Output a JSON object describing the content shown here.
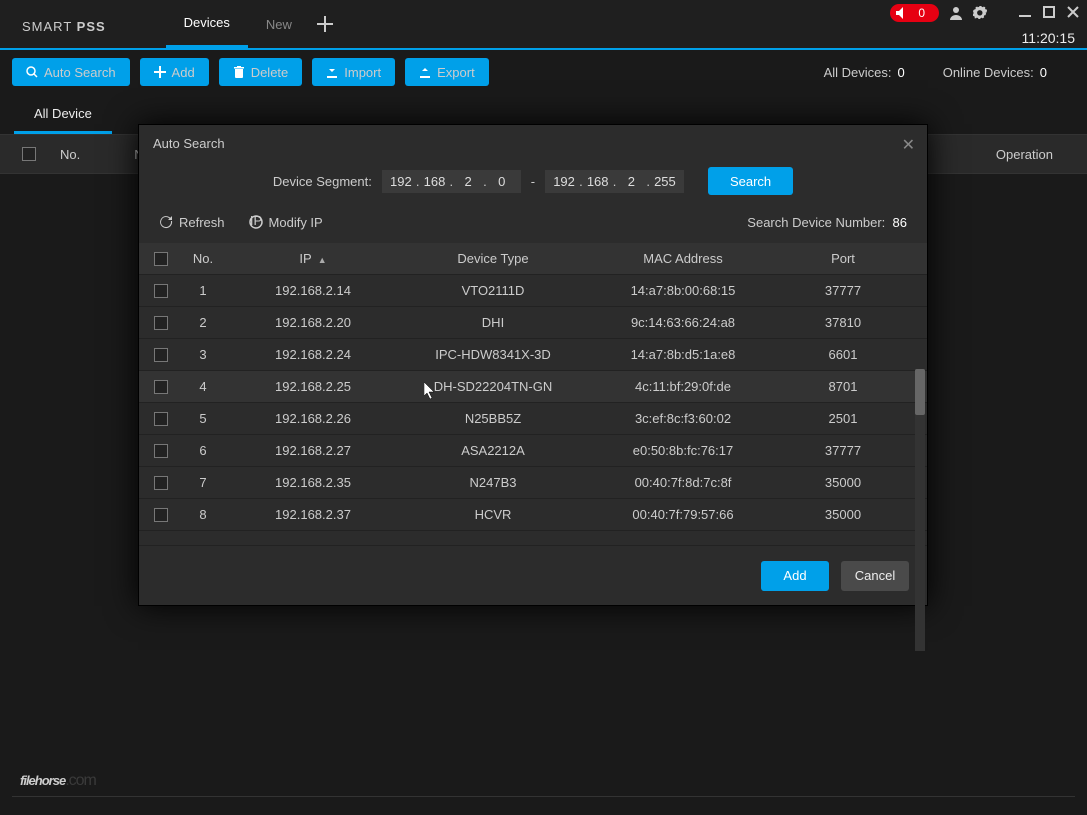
{
  "app": {
    "logo_pre": "SMART ",
    "logo_bold": "PSS",
    "clock": "11:20:15"
  },
  "tabs": {
    "devices": "Devices",
    "new": "New"
  },
  "volume": {
    "count": "0"
  },
  "toolbar": {
    "auto_search": "Auto Search",
    "add": "Add",
    "delete": "Delete",
    "import": "Import",
    "export": "Export",
    "all_devices_label": "All Devices:",
    "all_devices_val": "0",
    "online_devices_label": "Online Devices:",
    "online_devices_val": "0"
  },
  "subtabs": {
    "all_device": "All Device"
  },
  "main_header": {
    "no": "No.",
    "name": "Na",
    "operation": "Operation"
  },
  "modal": {
    "title": "Auto Search",
    "segment_label": "Device Segment:",
    "ip_from": [
      "192",
      "168",
      "2",
      "0"
    ],
    "ip_to": [
      "192",
      "168",
      "2",
      "255"
    ],
    "dash": "-",
    "search_btn": "Search",
    "refresh": "Refresh",
    "modify_ip": "Modify IP",
    "count_label": "Search Device Number:",
    "count_val": "86",
    "cols": {
      "no": "No.",
      "ip": "IP",
      "type": "Device Type",
      "mac": "MAC Address",
      "port": "Port"
    },
    "rows": [
      {
        "no": "1",
        "ip": "192.168.2.14",
        "type": "VTO2111D",
        "mac": "14:a7:8b:00:68:15",
        "port": "37777"
      },
      {
        "no": "2",
        "ip": "192.168.2.20",
        "type": "DHI",
        "mac": "9c:14:63:66:24:a8",
        "port": "37810"
      },
      {
        "no": "3",
        "ip": "192.168.2.24",
        "type": "IPC-HDW8341X-3D",
        "mac": "14:a7:8b:d5:1a:e8",
        "port": "6601"
      },
      {
        "no": "4",
        "ip": "192.168.2.25",
        "type": "DH-SD22204TN-GN",
        "mac": "4c:11:bf:29:0f:de",
        "port": "8701"
      },
      {
        "no": "5",
        "ip": "192.168.2.26",
        "type": "N25BB5Z",
        "mac": "3c:ef:8c:f3:60:02",
        "port": "2501"
      },
      {
        "no": "6",
        "ip": "192.168.2.27",
        "type": "ASA2212A",
        "mac": "e0:50:8b:fc:76:17",
        "port": "37777"
      },
      {
        "no": "7",
        "ip": "192.168.2.35",
        "type": "N247B3",
        "mac": "00:40:7f:8d:7c:8f",
        "port": "35000"
      },
      {
        "no": "8",
        "ip": "192.168.2.37",
        "type": "HCVR",
        "mac": "00:40:7f:79:57:66",
        "port": "35000"
      }
    ],
    "highlight_index": 3,
    "add_btn": "Add",
    "cancel_btn": "Cancel"
  },
  "watermark": {
    "brand": "filehorse",
    "tld": ".com"
  }
}
